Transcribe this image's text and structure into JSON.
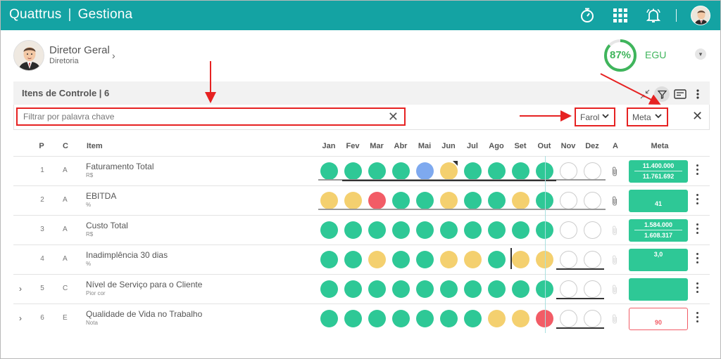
{
  "header": {
    "brand": "Quattrus",
    "product": "Gestiona",
    "icons": [
      "stopwatch-icon",
      "apps-grid-icon",
      "bell-icon",
      "user-avatar"
    ]
  },
  "profile": {
    "name": "Diretor Geral",
    "department": "Diretoria",
    "score": "87%",
    "score_value": 0.87,
    "score_label": "EGU"
  },
  "section": {
    "title": "Itens de Controle | 6"
  },
  "filters": {
    "search_placeholder": "Filtrar por palavra chave",
    "farol_label": "Farol",
    "meta_label": "Meta"
  },
  "table": {
    "headers": {
      "p": "P",
      "c": "C",
      "item": "Item",
      "months": [
        "Jan",
        "Fev",
        "Mar",
        "Abr",
        "Mai",
        "Jun",
        "Jul",
        "Ago",
        "Set",
        "Out",
        "Nov",
        "Dez"
      ],
      "a": "A",
      "meta": "Meta"
    },
    "rows": [
      {
        "p": "1",
        "c": "A",
        "name": "Faturamento Total",
        "unit": "R$",
        "expandable": false,
        "status": [
          "g",
          "g",
          "g",
          "g",
          "b",
          "y",
          "g",
          "g",
          "g",
          "g",
          "e",
          "e"
        ],
        "meta1": "11.400.000",
        "meta2": "11.761.692",
        "meta_style": "green"
      },
      {
        "p": "2",
        "c": "A",
        "name": "EBITDA",
        "unit": "%",
        "expandable": false,
        "status": [
          "y",
          "y",
          "r",
          "g",
          "g",
          "y",
          "g",
          "g",
          "y",
          "g",
          "e",
          "e"
        ],
        "meta1": "",
        "meta2": "41",
        "meta_style": "green"
      },
      {
        "p": "3",
        "c": "A",
        "name": "Custo Total",
        "unit": "R$",
        "expandable": false,
        "status": [
          "g",
          "g",
          "g",
          "g",
          "g",
          "g",
          "g",
          "g",
          "g",
          "g",
          "e",
          "e"
        ],
        "meta1": "1.584.000",
        "meta2": "1.608.317",
        "meta_style": "green"
      },
      {
        "p": "4",
        "c": "A",
        "name": "Inadimplência 30 dias",
        "unit": "%",
        "expandable": false,
        "status": [
          "g",
          "g",
          "y",
          "g",
          "g",
          "y",
          "y",
          "g",
          "y",
          "y",
          "e",
          "e"
        ],
        "meta1": "3,0",
        "meta2": "",
        "meta_style": "green"
      },
      {
        "p": "5",
        "c": "C",
        "name": "Nível de Serviço para o Cliente",
        "unit": "Pior cor",
        "expandable": true,
        "status": [
          "g",
          "g",
          "g",
          "g",
          "g",
          "g",
          "g",
          "g",
          "g",
          "g",
          "e",
          "e"
        ],
        "meta1": "",
        "meta2": "",
        "meta_style": "green"
      },
      {
        "p": "6",
        "c": "E",
        "name": "Qualidade de Vida no Trabalho",
        "unit": "Nota",
        "expandable": true,
        "status": [
          "g",
          "g",
          "g",
          "g",
          "g",
          "g",
          "g",
          "y",
          "y",
          "r",
          "e",
          "e"
        ],
        "meta1": "",
        "meta2": "90",
        "meta_style": "outline-red"
      }
    ]
  },
  "colors": {
    "brand_teal": "#14a3a3",
    "green": "#2ec896",
    "yellow": "#f4d06f",
    "red": "#f25c66",
    "blue": "#7ea9ef",
    "annotation_red": "#e62222"
  }
}
